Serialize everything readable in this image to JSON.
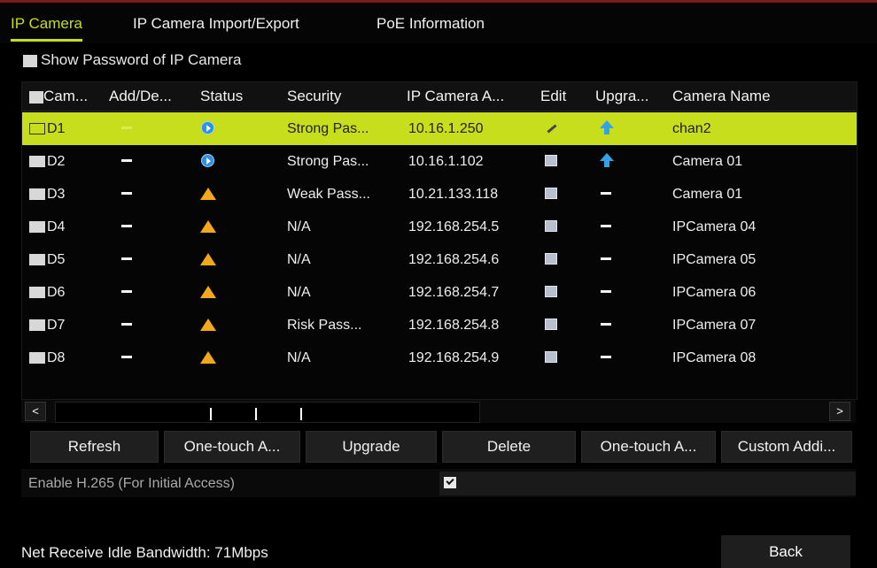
{
  "tabs": [
    "IP Camera",
    "IP Camera Import/Export",
    "PoE Information"
  ],
  "show_password_label": "Show Password of IP Camera",
  "table": {
    "headers": [
      "Cam...",
      "Add/De...",
      "Status",
      "Security",
      "IP Camera A...",
      "Edit",
      "Upgra...",
      "Camera Name"
    ],
    "rows": [
      {
        "id": "D1",
        "status": "play",
        "security": "Strong Pas...",
        "ip": "10.16.1.250",
        "upgrade": "upgrade",
        "name": "chan2",
        "selected": true
      },
      {
        "id": "D2",
        "status": "play",
        "security": "Strong Pas...",
        "ip": "10.16.1.102",
        "upgrade": "upgrade",
        "name": "Camera 01"
      },
      {
        "id": "D3",
        "status": "warning",
        "security": "Weak Pass...",
        "ip": "10.21.133.118",
        "upgrade": "none",
        "name": "Camera 01"
      },
      {
        "id": "D4",
        "status": "warning",
        "security": "N/A",
        "ip": "192.168.254.5",
        "upgrade": "none",
        "name": "IPCamera 04"
      },
      {
        "id": "D5",
        "status": "warning",
        "security": "N/A",
        "ip": "192.168.254.6",
        "upgrade": "none",
        "name": "IPCamera 05"
      },
      {
        "id": "D6",
        "status": "warning",
        "security": "N/A",
        "ip": "192.168.254.7",
        "upgrade": "none",
        "name": "IPCamera 06"
      },
      {
        "id": "D7",
        "status": "warning",
        "security": "Risk Pass...",
        "ip": "192.168.254.8",
        "upgrade": "none",
        "name": "IPCamera 07"
      },
      {
        "id": "D8",
        "status": "warning",
        "security": "N/A",
        "ip": "192.168.254.9",
        "upgrade": "none",
        "name": "IPCamera 08"
      }
    ]
  },
  "scroll": {
    "left": "<",
    "right": ">"
  },
  "buttons": [
    "Refresh",
    "One-touch A...",
    "Upgrade",
    "Delete",
    "One-touch A...",
    "Custom Addi..."
  ],
  "h265_label": "Enable H.265 (For Initial Access)",
  "bandwidth": "Net Receive Idle Bandwidth: 71Mbps",
  "back_label": "Back",
  "colors": {
    "accent": "#c6de1c",
    "warning": "#f2a81c",
    "info": "#2f8fe0"
  }
}
